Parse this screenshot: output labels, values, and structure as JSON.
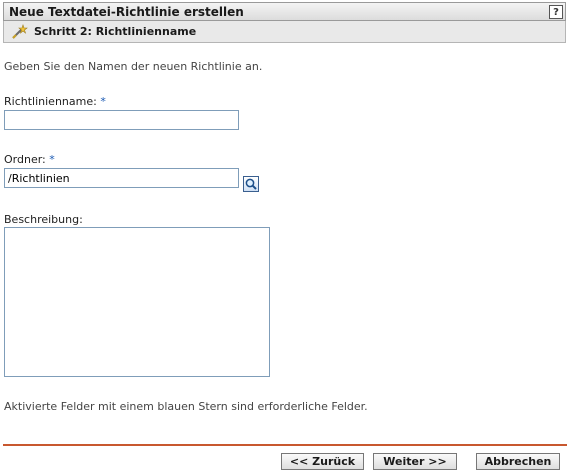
{
  "header": {
    "title": "Neue Textdatei-Richtlinie erstellen",
    "help_label": "?",
    "step": "Schritt 2: Richtlinienname"
  },
  "form": {
    "intro": "Geben Sie den Namen der neuen Richtlinie an.",
    "name_label": "Richtlinienname:",
    "name_value": "",
    "folder_label": "Ordner:",
    "folder_value": "/Richtlinien",
    "description_label": "Beschreibung:",
    "description_value": "",
    "required_marker": "*",
    "required_note": "Aktivierte Felder mit einem blauen Stern sind erforderliche Felder."
  },
  "buttons": {
    "back": "<< Zurück",
    "next": "Weiter >>",
    "cancel": "Abbrechen"
  },
  "icons": {
    "step": "wand-icon",
    "browse": "magnifier-icon"
  },
  "colors": {
    "divider": "#c8582f",
    "required": "#1b5ab3"
  }
}
